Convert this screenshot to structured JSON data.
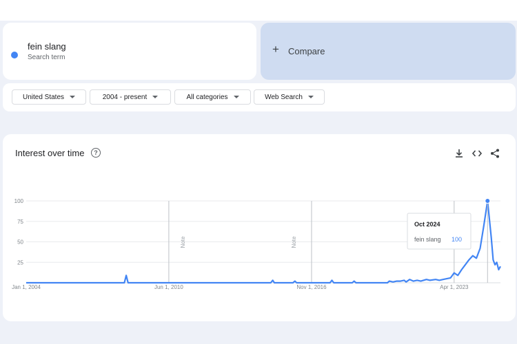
{
  "search_term": {
    "label": "fein slang",
    "sublabel": "Search term",
    "color": "#4285f4"
  },
  "compare": {
    "label": "Compare",
    "icon": "plus-icon"
  },
  "filters": [
    {
      "label": "United States"
    },
    {
      "label": "2004 - present"
    },
    {
      "label": "All categories"
    },
    {
      "label": "Web Search"
    }
  ],
  "card": {
    "title": "Interest over time",
    "help_icon": "help-icon",
    "actions": [
      "download-icon",
      "embed-icon",
      "share-icon"
    ]
  },
  "chart_data": {
    "type": "line",
    "title": "",
    "ylim": [
      0,
      100
    ],
    "y_ticks": [
      25,
      50,
      75,
      100
    ],
    "xlim": [
      "2004-01-01",
      "2025-05-01"
    ],
    "x_ticks": [
      {
        "date": "2004-01-01",
        "label": "Jan 1, 2004"
      },
      {
        "date": "2010-06-01",
        "label": "Jun 1, 2010"
      },
      {
        "date": "2016-11-01",
        "label": "Nov 1, 2016"
      },
      {
        "date": "2023-04-01",
        "label": "Apr 1, 2023"
      }
    ],
    "notes": [
      {
        "date": "2011-01-01",
        "label": "Note"
      },
      {
        "date": "2016-01-01",
        "label": "Note"
      }
    ],
    "series": [
      {
        "name": "fein slang",
        "color": "#4285f4",
        "points": [
          [
            "2004-01-01",
            0
          ],
          [
            "2008-06-01",
            0
          ],
          [
            "2008-07-01",
            9
          ],
          [
            "2008-08-01",
            0
          ],
          [
            "2015-01-01",
            0
          ],
          [
            "2015-02-01",
            3
          ],
          [
            "2015-03-01",
            0
          ],
          [
            "2016-01-01",
            0
          ],
          [
            "2016-02-01",
            2
          ],
          [
            "2016-03-01",
            0
          ],
          [
            "2017-09-01",
            0
          ],
          [
            "2017-10-01",
            3
          ],
          [
            "2017-11-01",
            0
          ],
          [
            "2018-09-01",
            0
          ],
          [
            "2018-10-01",
            2
          ],
          [
            "2018-11-01",
            0
          ],
          [
            "2020-04-01",
            0
          ],
          [
            "2020-05-01",
            2
          ],
          [
            "2020-07-01",
            1
          ],
          [
            "2020-09-01",
            2
          ],
          [
            "2020-11-01",
            2
          ],
          [
            "2021-01-01",
            3
          ],
          [
            "2021-02-01",
            1
          ],
          [
            "2021-04-01",
            4
          ],
          [
            "2021-06-01",
            2
          ],
          [
            "2021-08-01",
            3
          ],
          [
            "2021-10-01",
            2
          ],
          [
            "2022-01-01",
            4
          ],
          [
            "2022-03-01",
            3
          ],
          [
            "2022-06-01",
            4
          ],
          [
            "2022-08-01",
            3
          ],
          [
            "2022-10-01",
            4
          ],
          [
            "2022-12-01",
            5
          ],
          [
            "2023-02-01",
            6
          ],
          [
            "2023-04-01",
            12
          ],
          [
            "2023-06-01",
            9
          ],
          [
            "2023-08-01",
            16
          ],
          [
            "2023-10-01",
            22
          ],
          [
            "2023-12-01",
            28
          ],
          [
            "2024-02-01",
            33
          ],
          [
            "2024-04-01",
            30
          ],
          [
            "2024-06-01",
            42
          ],
          [
            "2024-08-01",
            70
          ],
          [
            "2024-10-01",
            100
          ],
          [
            "2024-12-01",
            55
          ],
          [
            "2025-01-01",
            28
          ],
          [
            "2025-02-01",
            22
          ],
          [
            "2025-03-01",
            25
          ],
          [
            "2025-04-01",
            16
          ],
          [
            "2025-05-01",
            20
          ]
        ]
      }
    ],
    "tooltip": {
      "date_label": "Oct 2024",
      "series": "fein slang",
      "value": 100
    },
    "grid": true,
    "legend": "none"
  }
}
